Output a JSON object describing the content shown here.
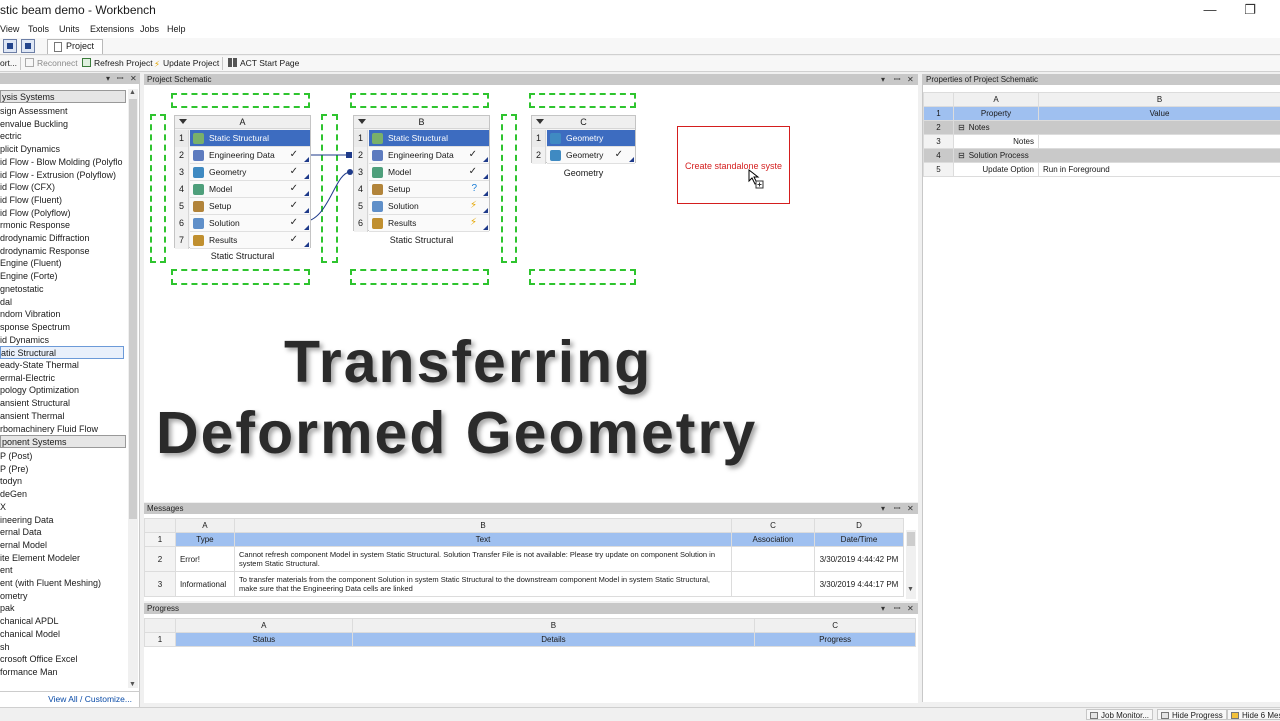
{
  "window": {
    "title": "stic beam demo - Workbench",
    "minimize": "—",
    "maximize": "❐"
  },
  "menu": [
    "View",
    "Tools",
    "Units",
    "Extensions",
    "Jobs",
    "Help"
  ],
  "tab": {
    "label": "Project"
  },
  "toolbar": {
    "import": "ort...",
    "reconnect": "Reconnect",
    "refresh": "Refresh Project",
    "update": "Update Project",
    "act": "ACT Start Page"
  },
  "toolbox": {
    "analysis_header": "ysis Systems",
    "analysis_items": [
      "sign Assessment",
      "envalue Buckling",
      "ectric",
      "plicit Dynamics",
      "id Flow - Blow Molding (Polyflo",
      "id Flow - Extrusion (Polyflow)",
      "id Flow (CFX)",
      "id Flow (Fluent)",
      "id Flow (Polyflow)",
      "rmonic Response",
      "drodynamic Diffraction",
      "drodynamic Response",
      "Engine (Fluent)",
      "Engine (Forte)",
      "gnetostatic",
      "dal",
      "ndom Vibration",
      "sponse Spectrum",
      "id Dynamics",
      "atic Structural",
      "eady-State Thermal",
      "ermal-Electric",
      "pology Optimization",
      "ansient Structural",
      "ansient Thermal",
      "rbomachinery Fluid Flow"
    ],
    "selected_index": 19,
    "component_header": "ponent Systems",
    "component_items": [
      "P (Post)",
      "P (Pre)",
      "todyn",
      "deGen",
      "X",
      "ineering Data",
      "ernal Data",
      "ernal Model",
      "ite Element Modeler",
      "ent",
      "ent (with Fluent Meshing)",
      "ometry",
      "pak",
      "chanical APDL",
      "chanical Model",
      "sh",
      "crosoft Office Excel",
      "formance Man"
    ],
    "view_all": "View All / Customize..."
  },
  "schematic": {
    "header": "Project Schematic",
    "systems": [
      {
        "letter": "A",
        "name": "Static Structural",
        "rows": [
          {
            "n": "1",
            "label": "Static Structural",
            "status": ""
          },
          {
            "n": "2",
            "label": "Engineering Data",
            "status": "✓"
          },
          {
            "n": "3",
            "label": "Geometry",
            "status": "✓"
          },
          {
            "n": "4",
            "label": "Model",
            "status": "✓"
          },
          {
            "n": "5",
            "label": "Setup",
            "status": "✓"
          },
          {
            "n": "6",
            "label": "Solution",
            "status": "✓"
          },
          {
            "n": "7",
            "label": "Results",
            "status": "✓"
          }
        ]
      },
      {
        "letter": "B",
        "name": "Static Structural",
        "rows": [
          {
            "n": "1",
            "label": "Static Structural",
            "status": ""
          },
          {
            "n": "2",
            "label": "Engineering Data",
            "status": "✓"
          },
          {
            "n": "3",
            "label": "Model",
            "status": "✓"
          },
          {
            "n": "4",
            "label": "Setup",
            "status": "?"
          },
          {
            "n": "5",
            "label": "Solution",
            "status": "⚡"
          },
          {
            "n": "6",
            "label": "Results",
            "status": "⚡"
          }
        ]
      },
      {
        "letter": "C",
        "name": "Geometry",
        "rows": [
          {
            "n": "1",
            "label": "Geometry",
            "status": ""
          },
          {
            "n": "2",
            "label": "Geometry",
            "status": "✓"
          }
        ]
      }
    ],
    "create_standalone": "Create standalone syste",
    "overlay_line1": "Transferring",
    "overlay_line2": "Deformed Geometry"
  },
  "properties": {
    "header": "Properties of Project Schematic",
    "col_a": "A",
    "col_b": "B",
    "rows": [
      {
        "n": "1",
        "a": "Property",
        "b": "Value"
      },
      {
        "n": "2",
        "a": "Notes",
        "b": ""
      },
      {
        "n": "3",
        "a": "Notes",
        "b": ""
      },
      {
        "n": "4",
        "a": "Solution Process",
        "b": ""
      },
      {
        "n": "5",
        "a": "Update Option",
        "b": "Run in Foreground"
      }
    ]
  },
  "messages": {
    "header": "Messages",
    "cols": [
      "A",
      "B",
      "C",
      "D"
    ],
    "titles": [
      "Type",
      "Text",
      "Association",
      "Date/Time"
    ],
    "rows": [
      {
        "n": "2",
        "type": "Error!",
        "text": "Cannot refresh component Model in system Static Structural. Solution Transfer File is not available: Please try update on component Solution in system Static Structural.",
        "assoc": "",
        "date": "3/30/2019 4:44:42 PM"
      },
      {
        "n": "3",
        "type": "Informational",
        "text": "To transfer materials from the component Solution in system Static Structural to the downstream component Model in system Static Structural, make sure that the Engineering Data cells are linked",
        "assoc": "",
        "date": "3/30/2019 4:44:17 PM"
      }
    ]
  },
  "progress": {
    "header": "Progress",
    "cols": [
      "A",
      "B",
      "C"
    ],
    "titles": [
      "Status",
      "Details",
      "Progress"
    ]
  },
  "statusbar": {
    "job_monitor": "Job Monitor...",
    "hide_progress": "Hide Progress",
    "hide_messages": "Hide 6 Mes"
  },
  "colors": {
    "accent": "#3d6cc0",
    "drop_zone": "#2ec42e",
    "error": "#d41e1e"
  }
}
